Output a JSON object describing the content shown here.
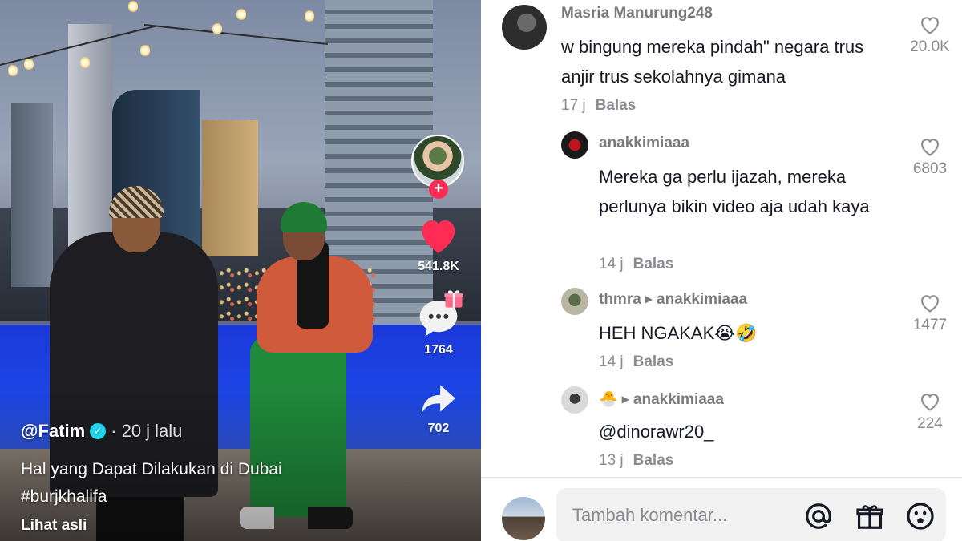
{
  "video": {
    "author_handle": "@Fatim",
    "posted_ago": "· 20 j lalu",
    "description_line1": "Hal yang Dapat Dilakukan di Dubai",
    "description_line2": "#burjkhalifa",
    "see_original": "Lihat asli",
    "likes": "541.8K",
    "comments": "1764",
    "shares": "702",
    "follow_symbol": "+",
    "icons": [
      "heart-icon",
      "comment-icon",
      "gift-icon",
      "share-icon",
      "verified-icon"
    ],
    "accent_color": "#fe2c55"
  },
  "comments": [
    {
      "user": "Masria Manurung248",
      "text": "w bingung mereka pindah\" negara trus anjir trus sekolahnya gimana",
      "time": "17 j",
      "reply_label": "Balas",
      "likes": "20.0K"
    },
    {
      "user": "anakkimiaaa",
      "text": "Mereka ga perlu ijazah, mereka perlunya bikin video aja udah kaya",
      "time": "14 j",
      "reply_label": "Balas",
      "likes": "6803"
    },
    {
      "user": "thmra",
      "reply_to": "anakkimiaaa",
      "text": "HEH NGAKAK😭🤣",
      "time": "14 j",
      "reply_label": "Balas",
      "likes": "1477"
    },
    {
      "user": "🐣",
      "reply_to": "anakkimiaaa",
      "text": "@dinorawr20_",
      "time": "13 j",
      "reply_label": "Balas",
      "likes": "224"
    }
  ],
  "input": {
    "placeholder": "Tambah komentar...",
    "icons": [
      "mention-icon",
      "gift-icon",
      "emoji-icon"
    ]
  }
}
